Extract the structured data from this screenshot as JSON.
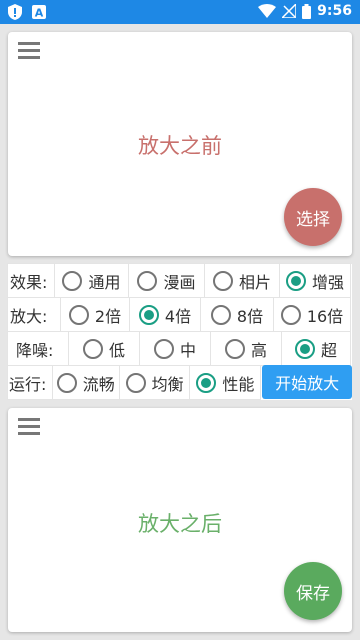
{
  "status_bar": {
    "time": "9:56"
  },
  "before_card": {
    "text": "放大之前",
    "button_label": "选择"
  },
  "after_card": {
    "text": "放大之后",
    "button_label": "保存"
  },
  "options": {
    "effect": {
      "label": "效果:",
      "choices": [
        "通用",
        "漫画",
        "相片",
        "增强"
      ],
      "selected": "增强"
    },
    "scale": {
      "label": "放大:",
      "choices": [
        "2倍",
        "4倍",
        "8倍",
        "16倍"
      ],
      "selected": "4倍"
    },
    "denoise": {
      "label": "降噪:",
      "choices": [
        "低",
        "中",
        "高",
        "超"
      ],
      "selected": "超"
    },
    "run": {
      "label": "运行:",
      "choices": [
        "流畅",
        "均衡",
        "性能"
      ],
      "selected": "性能",
      "start_button": "开始放大"
    }
  },
  "colors": {
    "status_bar": "#1e88e5",
    "before_text": "#c8706c",
    "after_text": "#6ab06a",
    "radio_accent": "#1a9e84",
    "start_button": "#2f9ef2"
  }
}
